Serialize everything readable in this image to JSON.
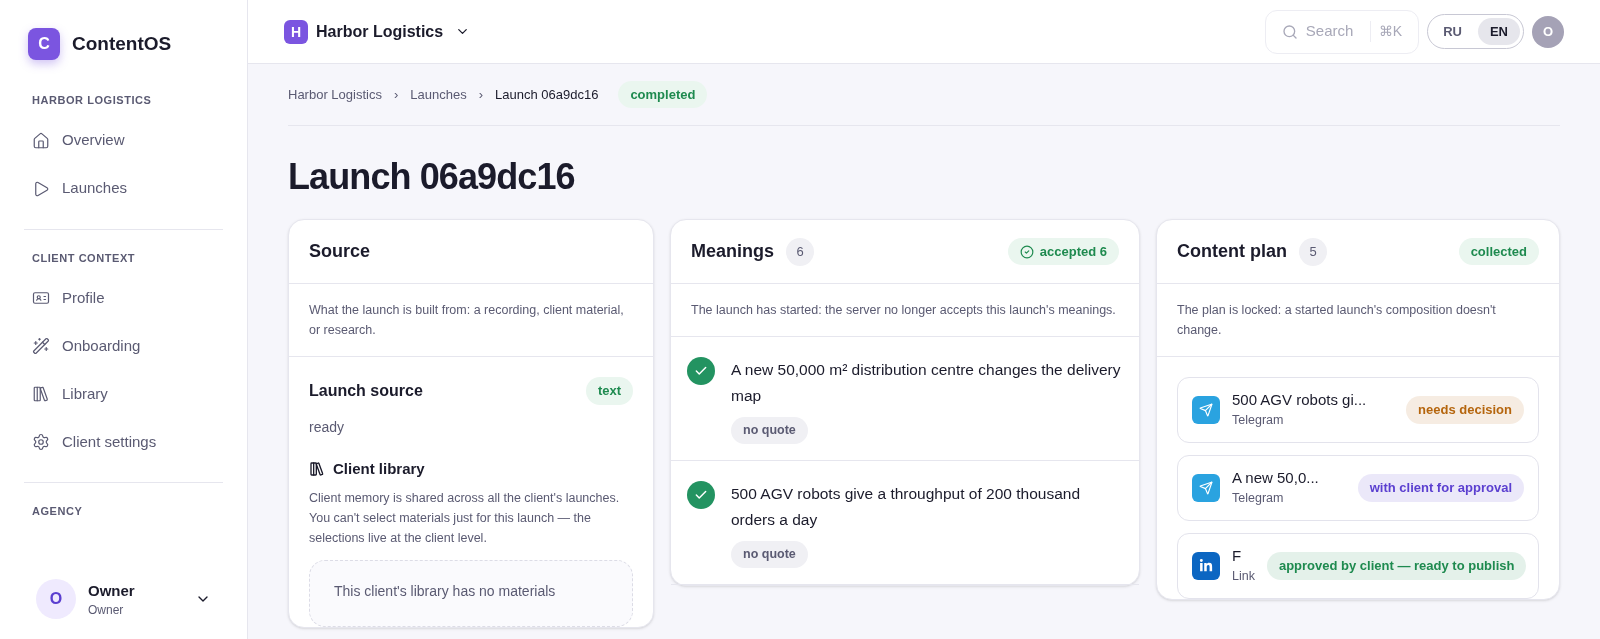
{
  "app": {
    "logo_letter": "C",
    "name": "ContentOS"
  },
  "sidebar": {
    "sections": [
      {
        "title": "HARBOR LOGISTICS",
        "items": [
          {
            "label": "Overview",
            "selected": false
          },
          {
            "label": "Launches",
            "selected": false
          }
        ]
      },
      {
        "title": "CLIENT CONTEXT",
        "items": [
          {
            "label": "Profile",
            "selected": false
          },
          {
            "label": "Onboarding",
            "selected": false
          },
          {
            "label": "Library",
            "selected": false
          },
          {
            "label": "Client settings",
            "selected": false
          }
        ]
      },
      {
        "title": "AGENCY"
      }
    ],
    "user": {
      "avatar_letter": "O",
      "name": "Owner",
      "role": "Owner"
    }
  },
  "topbar": {
    "client": {
      "letter": "H",
      "name": "Harbor Logistics"
    },
    "search": {
      "placeholder": "Search",
      "shortcut": "⌘K"
    },
    "languages": [
      {
        "label": "RU",
        "selected": false
      },
      {
        "label": "EN",
        "selected": true
      }
    ],
    "avatar_letter": "O"
  },
  "breadcrumbs": [
    {
      "label": "Harbor Logistics",
      "separator": "›"
    },
    {
      "label": "Launches",
      "separator": "›"
    },
    {
      "label": "Launch 06a9dc16"
    }
  ],
  "status": "completed",
  "title": "Launch 06a9dc16",
  "source": {
    "title": "Source",
    "description": "What the launch is built from: a recording, client material, or research.",
    "launch_source": {
      "title": "Launch source",
      "badge": "text",
      "state": "ready"
    },
    "library": {
      "title": "Client library",
      "description": "Client memory is shared across all the client's launches. You can't select materials just for this launch — the selections live at the client level.",
      "empty": "This client's library has no materials"
    }
  },
  "meanings": {
    "title": "Meanings",
    "count": "6",
    "badge": "accepted 6",
    "description": "The launch has started: the server no longer accepts this launch's meanings.",
    "items": [
      {
        "text": "A new 50,000 m² distribution centre changes the delivery map",
        "accepted": true,
        "tag": "no quote"
      },
      {
        "text": "500 AGV robots give a throughput of 200 thousand orders a day",
        "accepted": true,
        "tag": "no quote"
      }
    ]
  },
  "content_plan": {
    "title": "Content plan",
    "count": "5",
    "badge": "collected",
    "description": "The plan is locked: a started launch's composition doesn't change.",
    "items": [
      {
        "kind": "telegram",
        "title": "500 AGV robots gi...",
        "platform": "Telegram",
        "status": "needs decision",
        "color": "#b5650d"
      },
      {
        "kind": "telegram",
        "title": "A new 50,0...",
        "platform": "Telegram",
        "status": "with client for approval",
        "color": "#5b3fd0"
      },
      {
        "kind": "linkedin",
        "title": "F",
        "platform": "Link",
        "status": "approved by client — ready to publish",
        "color": "#1e8a4f"
      }
    ]
  }
}
